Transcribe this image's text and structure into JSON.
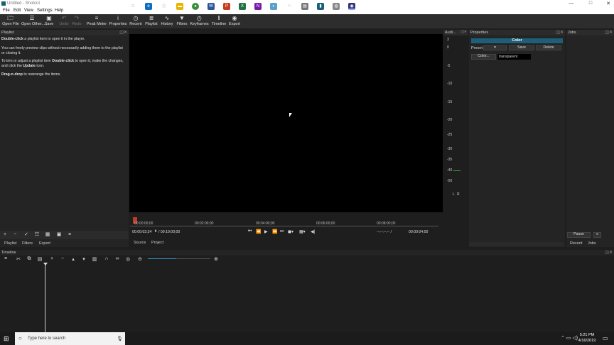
{
  "window": {
    "title": "Untitled - Shotcut",
    "minimize": "—",
    "maximize": "□",
    "close": "✕"
  },
  "menu": [
    "File",
    "Edit",
    "View",
    "Settings",
    "Help"
  ],
  "toolbar": [
    {
      "label": "Open File",
      "icon": "folder-icon",
      "glyph": "🗁"
    },
    {
      "label": "Open Other...",
      "icon": "open-other-icon",
      "glyph": "☰"
    },
    {
      "label": "Save",
      "icon": "save-icon",
      "glyph": "▣"
    },
    {
      "label": "Undo",
      "icon": "undo-icon",
      "glyph": "↶"
    },
    {
      "label": "Redo",
      "icon": "redo-icon",
      "glyph": "↷"
    },
    {
      "label": "Peak Meter",
      "icon": "peak-meter-icon",
      "glyph": "≡"
    },
    {
      "label": "Properties",
      "icon": "info-icon",
      "glyph": "i"
    },
    {
      "label": "Recent",
      "icon": "clock-icon",
      "glyph": "◷"
    },
    {
      "label": "Playlist",
      "icon": "playlist-icon",
      "glyph": "≣"
    },
    {
      "label": "History",
      "icon": "history-icon",
      "glyph": "∿"
    },
    {
      "label": "Filters",
      "icon": "filter-icon",
      "glyph": "▼"
    },
    {
      "label": "Keyframes",
      "icon": "keyframes-icon",
      "glyph": "◴"
    },
    {
      "label": "Timeline",
      "icon": "timeline-icon",
      "glyph": "‖"
    },
    {
      "label": "Export",
      "icon": "export-icon",
      "glyph": "◉"
    }
  ],
  "playlist": {
    "header": "Playlist",
    "p1_bold": "Double-click",
    "p1": " a playlist item to open it in the player.",
    "p2": "You can freely preview clips without necessarily adding them to the playlist or closing it.",
    "p3a": "To trim or adjust a playlist item ",
    "p3_bold": "Double-click",
    "p3b": " to open it, make the changes, and click the ",
    "p3_bold2": "Update",
    "p3c": " icon.",
    "p4_bold": "Drag-n-drop",
    "p4": " to rearrange the items.",
    "tabs": [
      "Playlist",
      "Filters",
      "Export"
    ]
  },
  "player": {
    "ticks": [
      "00:00:00;00",
      "00:02:00;00",
      "00:04:00;00",
      "00:06:00;00",
      "00:08:00;00"
    ],
    "position": "00:00:03;24",
    "duration": "/ 00:10:00;00",
    "in_point": "--:--:--:-- /",
    "out_point": "00:00:04;00",
    "tabs": [
      "Source",
      "Project"
    ]
  },
  "audio": {
    "header": "Audi...",
    "levels": [
      "3",
      "0",
      "-5",
      "-10",
      "-15",
      "-20",
      "-25",
      "-30",
      "-35",
      "-40",
      "-50"
    ],
    "l": "L",
    "r": "R"
  },
  "properties": {
    "header": "Properties",
    "title": "Color",
    "preset_label": "Preset",
    "save": "Save",
    "delete": "Delete",
    "color_button": "Color...",
    "color_value": "transparent"
  },
  "jobs": {
    "header": "Jobs",
    "pause": "Pause",
    "tabs": [
      "Recent",
      "Jobs"
    ]
  },
  "timeline": {
    "header": "Timeline"
  },
  "taskbar": {
    "search_placeholder": "Type here to search",
    "time": "5:21 PM",
    "date": "4/16/2019"
  },
  "colors": {
    "accent": "#1d5f78",
    "bg": "#1e1e1e",
    "viewer": "#000000"
  }
}
